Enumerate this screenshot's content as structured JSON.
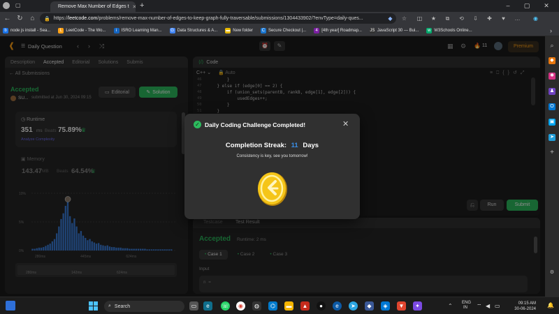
{
  "browser": {
    "tab_title": "Remove Max Number of Edges t",
    "url_prefix": "https://",
    "url_host": "leetcode.com",
    "url_rest": "/problems/remove-max-number-of-edges-to-keep-graph-fully-traversable/submissions/1304433902/?envType=daily-ques...",
    "new_tab": "+",
    "bookmarks": [
      {
        "label": "node js install - Sea...",
        "color": "#1a73e8",
        "glyph": "b"
      },
      {
        "label": "LeetCode - The Wo...",
        "color": "#ffa116",
        "glyph": "L"
      },
      {
        "label": "ISRO Learning Man...",
        "color": "#1565c0",
        "glyph": "i"
      },
      {
        "label": "Data Structures & A...",
        "color": "#4285f4",
        "glyph": "G"
      },
      {
        "label": "New folder",
        "color": "#e8b800",
        "glyph": "▬"
      },
      {
        "label": "Secure Checkout |...",
        "color": "#1976d2",
        "glyph": "C"
      },
      {
        "label": "[4th year] Roadmap...",
        "color": "#7b1fa2",
        "glyph": "4"
      },
      {
        "label": "JavaScript 30 — Bui...",
        "color": "#333333",
        "glyph": "JS"
      },
      {
        "label": "W3Schools Online...",
        "color": "#04aa6d",
        "glyph": "w"
      }
    ]
  },
  "lc": {
    "daily_question": "Daily Question",
    "streak_count": "11",
    "premium": "Premium",
    "left_tabs": [
      "Description",
      "Accepted",
      "Editorial",
      "Solutions",
      "Submis"
    ],
    "all_submissions": "All Submissions",
    "status": "Accepted",
    "submitter": "SU...",
    "submitted_at": "submitted at Jun 30, 2024 09:15",
    "editorial_btn": "Editorial",
    "solution_btn": "Solution",
    "runtime_label": "Runtime",
    "runtime_value": "351",
    "runtime_unit": "ms",
    "runtime_beats_label": "Beats",
    "runtime_beats": "75.89%",
    "analyze": "Analyze Complexity",
    "memory_label": "Memory",
    "memory_value": "143.47",
    "memory_unit": "MB",
    "memory_beats_label": "Beats",
    "memory_beats": "64.54%",
    "chart_y": [
      "10%",
      "5%",
      "0%"
    ],
    "chart_x": [
      "280ms",
      "445ms",
      "624ms"
    ],
    "chart_x2": [
      "280ms",
      "142ms",
      "624ms"
    ],
    "code_title": "Code",
    "language": "C++",
    "auto": "Auto",
    "code_lines": [
      {
        "n": "46",
        "t": "        }"
      },
      {
        "n": "47",
        "t": "    } else if (edge[0] == 2) {"
      },
      {
        "n": "48",
        "t": "        if (union_sets(parentB, rankB, edge[1], edge[2])) {"
      },
      {
        "n": "49",
        "t": "            usedEdges++;"
      },
      {
        "n": "50",
        "t": "        }"
      },
      {
        "n": "51",
        "t": "    }"
      }
    ],
    "run": "Run",
    "submit": "Submit",
    "bottom_tabs": [
      "Testcase",
      "Test Result"
    ],
    "result_status": "Accepted",
    "result_runtime": "Runtime: 2 ms",
    "cases": [
      "Case 1",
      "Case 2",
      "Case 3"
    ],
    "input_label": "Input",
    "input_var": "n ="
  },
  "modal": {
    "title": "Daily Coding Challenge Completed!",
    "streak_label": "Completion Streak:",
    "streak_value": "11",
    "streak_unit": "Days",
    "message": "Consistency is key, see you tomorrow!",
    "close": "✕"
  },
  "taskbar": {
    "search": "Search",
    "lang1": "ENG",
    "lang2": "IN",
    "time": "09:15 AM",
    "date": "30-06-2024"
  },
  "chart_data": {
    "type": "bar",
    "title": "",
    "xlabel": "",
    "ylabel": "",
    "ylim": [
      0,
      10
    ],
    "yticks": [
      "0%",
      "5%",
      "10%"
    ],
    "xticks": [
      "280ms",
      "445ms",
      "624ms"
    ],
    "values": [
      0.3,
      0.3,
      0.4,
      0.5,
      0.5,
      0.6,
      0.8,
      1.0,
      1.2,
      1.6,
      2.0,
      3.0,
      4.2,
      5.5,
      6.5,
      7.8,
      8.6,
      6.0,
      4.8,
      5.6,
      4.2,
      3.0,
      3.4,
      2.6,
      2.2,
      1.8,
      2.0,
      1.6,
      1.4,
      1.2,
      1.3,
      1.0,
      0.9,
      0.8,
      0.9,
      0.7,
      0.6,
      0.6,
      0.5,
      0.5,
      0.5,
      0.4,
      0.4,
      0.4,
      0.3,
      0.3,
      0.3,
      0.3,
      0.3,
      0.3,
      0.3,
      0.3,
      0.2,
      0.2,
      0.2,
      0.2,
      0.2,
      0.2,
      0.2,
      0.2,
      0.2,
      0.2,
      0.2,
      0.2
    ]
  }
}
